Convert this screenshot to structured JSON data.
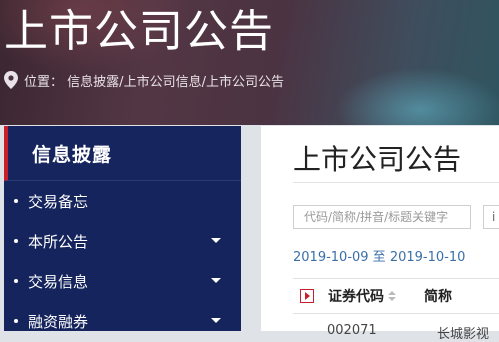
{
  "header": {
    "title": "上市公司公告",
    "breadcrumb": {
      "prefix": "位置：",
      "items": [
        "信息披露",
        "上市公司信息",
        "上市公司公告"
      ],
      "separator": "/"
    }
  },
  "sidebar": {
    "title": "信息披露",
    "accent_color": "#c8202a",
    "background_color": "#15245c",
    "items": [
      {
        "label": "交易备忘",
        "has_submenu": false
      },
      {
        "label": "本所公告",
        "has_submenu": true
      },
      {
        "label": "交易信息",
        "has_submenu": true
      },
      {
        "label": "融资融券",
        "has_submenu": true
      }
    ]
  },
  "main": {
    "title": "上市公司公告",
    "search": {
      "placeholder": "代码/简称/拼音/标题关键字",
      "value": "",
      "button_label": "i"
    },
    "date_range": "2019-10-09 至 2019-10-10",
    "table": {
      "columns": [
        "证券代码",
        "简称"
      ],
      "first_row": [
        "002071",
        "长城影视"
      ]
    }
  }
}
